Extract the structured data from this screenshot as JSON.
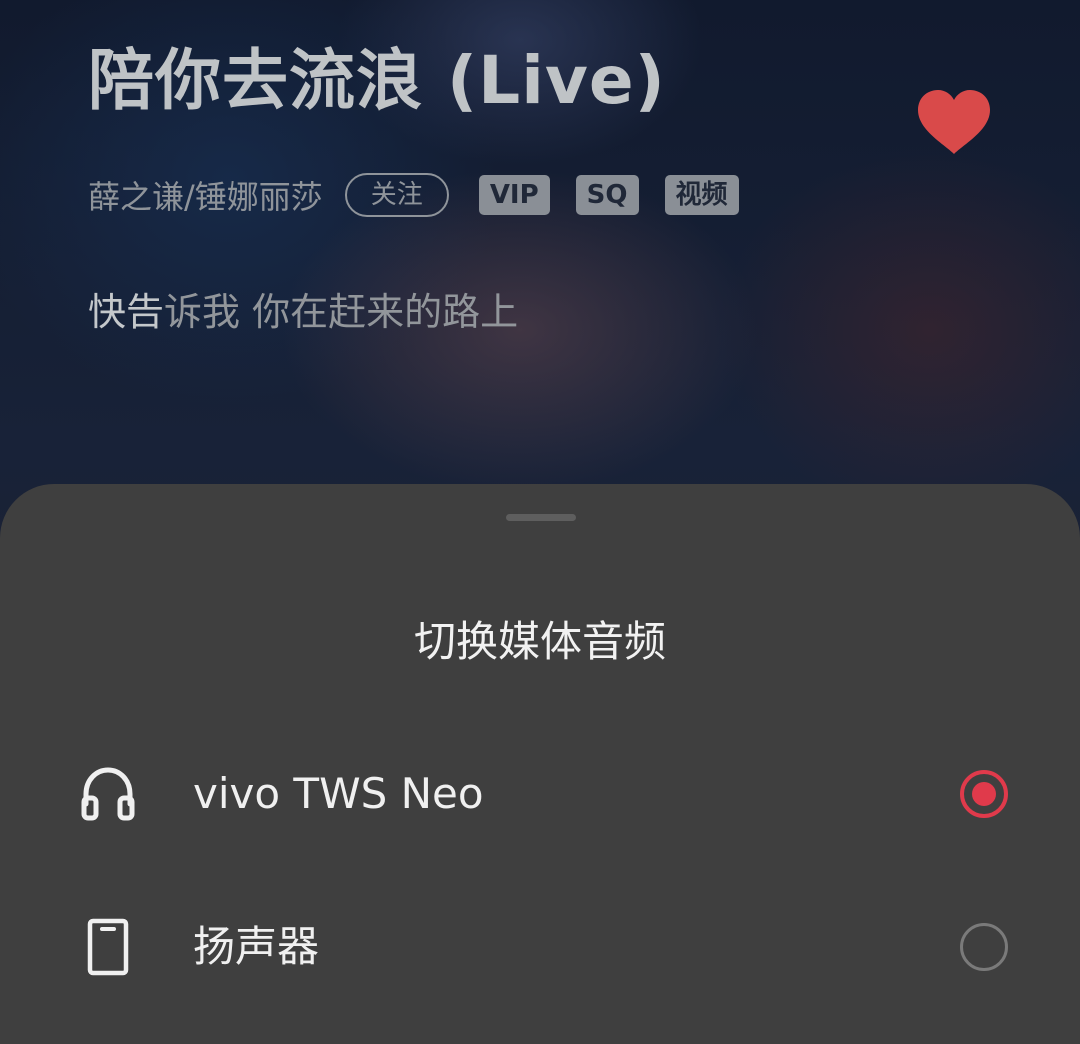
{
  "player": {
    "title": "陪你去流浪 (Live)",
    "artist": "薛之谦/锤娜丽莎",
    "follow_label": "关注",
    "tags": [
      "VIP",
      "SQ",
      "视频"
    ],
    "lyric_highlight": "快告",
    "lyric_rest": "诉我 你在赶来的路上",
    "favorited": true,
    "accent_color": "#d94a4a"
  },
  "sheet": {
    "title": "切换媒体音频",
    "devices": [
      {
        "label": "vivo TWS Neo",
        "icon": "headphones-icon",
        "selected": true
      },
      {
        "label": "扬声器",
        "icon": "phone-speaker-icon",
        "selected": false
      }
    ],
    "accent_color": "#e03a4b"
  }
}
